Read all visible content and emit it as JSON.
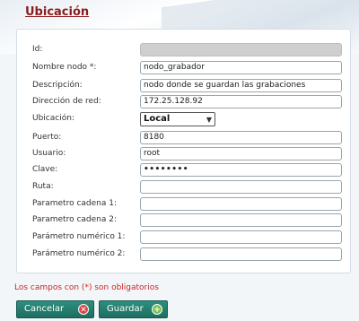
{
  "page": {
    "title": "Ubicación"
  },
  "form": {
    "id": {
      "label": "Id:",
      "value": ""
    },
    "nombre_nodo": {
      "label": "Nombre nodo *:",
      "value": "nodo_grabador"
    },
    "descripcion": {
      "label": "Descripción:",
      "value": "nodo donde se guardan las grabaciones"
    },
    "direccion_red": {
      "label": "Dirección de red:",
      "value": "172.25.128.92"
    },
    "ubicacion": {
      "label": "Ubicación:",
      "value": "Local",
      "icon": "chevron-down-icon"
    },
    "puerto": {
      "label": "Puerto:",
      "value": "8180"
    },
    "usuario": {
      "label": "Usuario:",
      "value": "root"
    },
    "clave": {
      "label": "Clave:",
      "value": "••••••••"
    },
    "ruta": {
      "label": "Ruta:",
      "value": ""
    },
    "param_cadena_1": {
      "label": "Parametro cadena 1:",
      "value": ""
    },
    "param_cadena_2": {
      "label": "Parametro cadena 2:",
      "value": ""
    },
    "param_numerico_1": {
      "label": "Parámetro numérico 1:",
      "value": ""
    },
    "param_numerico_2": {
      "label": "Parámetro numérico 2:",
      "value": ""
    }
  },
  "note": "Los campos con (*) son obligatorios",
  "buttons": {
    "cancel": {
      "label": "Cancelar",
      "icon": "close-icon",
      "icon_color": "#d94545"
    },
    "save": {
      "label": "Guardar",
      "icon": "plus-icon",
      "icon_color": "#7bbf5a"
    }
  },
  "colors": {
    "title": "#8a1d1d",
    "button": "#1d6e61",
    "required_note": "#cc2222"
  }
}
